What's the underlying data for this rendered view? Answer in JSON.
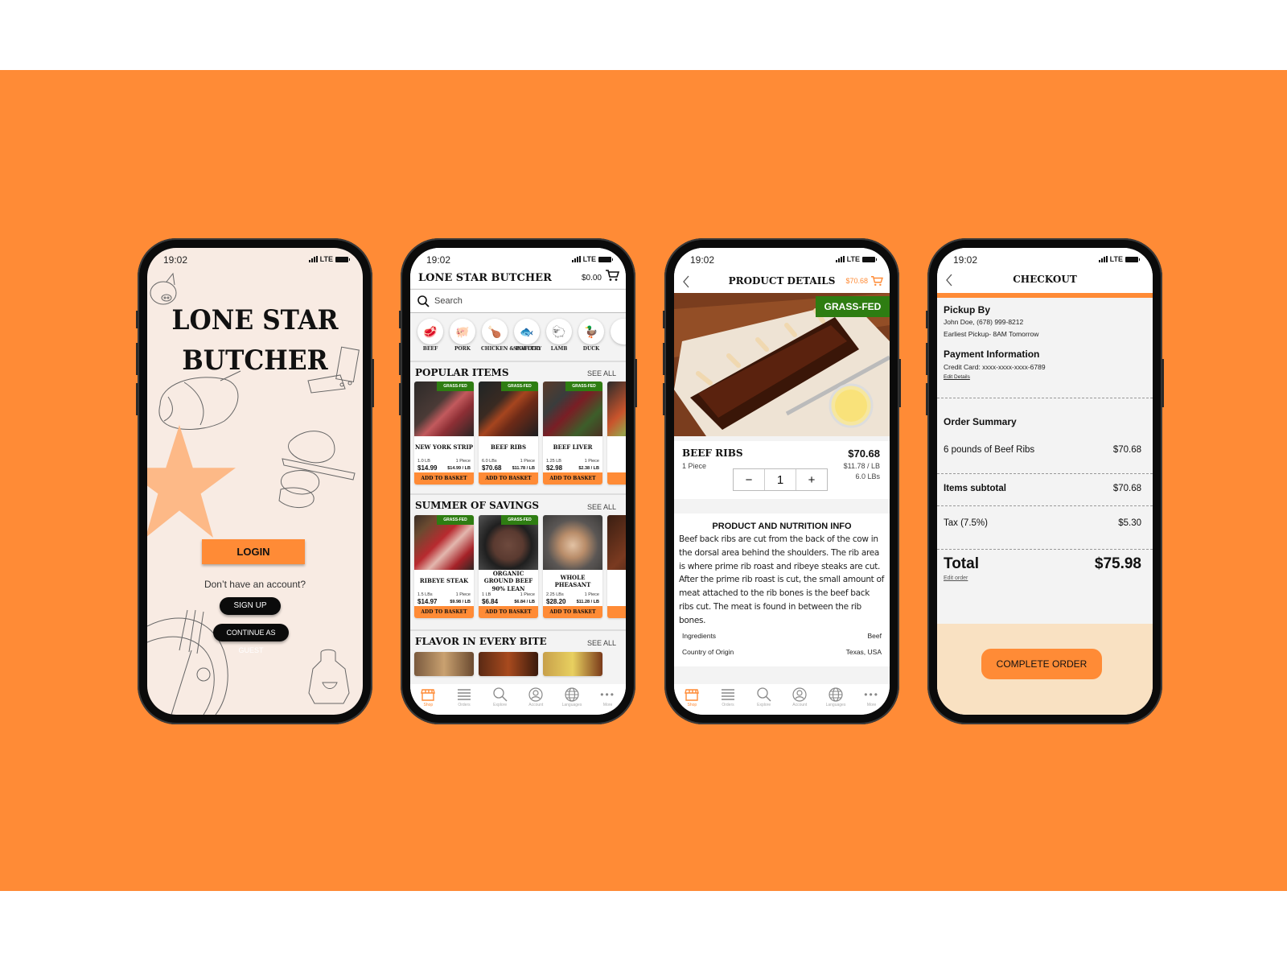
{
  "status_bar": {
    "time": "19:02",
    "network": "LTE"
  },
  "colors": {
    "brand_orange": "#ff8b36",
    "grass_fed_green": "#2e7d12",
    "login_bg": "#f8ebe3",
    "checkout_footer": "#f9e1c2"
  },
  "login_screen": {
    "title_line1": "LONE STAR",
    "title_line2": "BUTCHER",
    "login_label": "LOGIN",
    "no_account_text": "Don’t have an account?",
    "sign_up_label": "SIGN UP",
    "guest_label": "CONTINUE AS GUEST"
  },
  "shop_screen": {
    "brand": "LONE STAR BUTCHER",
    "cart_total": "$0.00",
    "search_placeholder": "Search",
    "categories": [
      {
        "label": "BEEF",
        "icon": "beef-icon"
      },
      {
        "label": "PORK",
        "icon": "pig-icon"
      },
      {
        "label": "CHICKEN & POULTRY",
        "icon": "chicken-icon"
      },
      {
        "label": "SEAFOOD",
        "icon": "fish-icon"
      },
      {
        "label": "LAMB",
        "icon": "lamb-icon"
      },
      {
        "label": "DUCK",
        "icon": "duck-icon"
      }
    ],
    "sections": [
      {
        "title": "POPULAR ITEMS",
        "see_all": "SEE ALL",
        "items": [
          {
            "name": "NEW YORK STRIP",
            "weight": "1.0 LB",
            "pieces": "1 Piece",
            "price": "$14.99",
            "per_lb": "$14.99 / LB",
            "badge": "GRASS-FED",
            "add": "ADD TO BASKET"
          },
          {
            "name": "BEEF RIBS",
            "weight": "6.0 LBs",
            "pieces": "1 Piece",
            "price": "$70.68",
            "per_lb": "$11.78 / LB",
            "badge": "GRASS-FED",
            "add": "ADD TO BASKET"
          },
          {
            "name": "BEEF LIVER",
            "weight": "1.25 LB",
            "pieces": "1 Piece",
            "price": "$2.98",
            "per_lb": "$2.38 / LB",
            "badge": "GRASS-FED",
            "add": "ADD TO BASKET"
          }
        ]
      },
      {
        "title": "SUMMER OF SAVINGS",
        "see_all": "SEE ALL",
        "items": [
          {
            "name": "RIBEYE STEAK",
            "weight": "1.5 LBs",
            "pieces": "1 Piece",
            "price": "$14.97",
            "per_lb": "$9.98 / LB",
            "badge": "GRASS-FED",
            "add": "ADD TO BASKET"
          },
          {
            "name": "ORGANIC GROUND BEEF 90% LEAN",
            "weight": "1 LB",
            "pieces": "1 Piece",
            "price": "$6.84",
            "per_lb": "$6.84 / LB",
            "badge": "GRASS-FED",
            "add": "ADD TO BASKET"
          },
          {
            "name": "WHOLE PHEASANT",
            "weight": "2.25 LBs",
            "pieces": "1 Piece",
            "price": "$28.20",
            "per_lb": "$11.28 / LB",
            "badge": "",
            "add": "ADD TO BASKET"
          }
        ]
      },
      {
        "title": "FLAVOR IN EVERY BITE",
        "see_all": "SEE ALL"
      }
    ]
  },
  "tab_bar": [
    {
      "label": "Shop",
      "icon": "shop-icon",
      "active": true
    },
    {
      "label": "Orders",
      "icon": "list-icon",
      "active": false
    },
    {
      "label": "Explore",
      "icon": "search-icon",
      "active": false
    },
    {
      "label": "Account",
      "icon": "account-icon",
      "active": false
    },
    {
      "label": "Languages",
      "icon": "globe-icon",
      "active": false
    },
    {
      "label": "More",
      "icon": "more-icon",
      "active": false
    }
  ],
  "product_screen": {
    "title": "PRODUCT DETAILS",
    "cart_total": "$70.68",
    "badge": "GRASS-FED",
    "name": "BEEF RIBS",
    "pieces": "1 Piece",
    "price": "$70.68",
    "per_lb": "$11.78 / LB",
    "weight": "6.0 LBs",
    "quantity": "1",
    "minus": "−",
    "plus": "+",
    "info_title": "PRODUCT AND NUTRITION INFO",
    "description": "Beef back ribs are cut from the back of the cow in the dorsal area behind the shoulders. The rib area is where prime rib roast and ribeye steaks are cut. After the prime rib roast is cut, the small amount of meat attached to the rib bones is the beef back ribs cut. The meat is found in between the rib bones.",
    "facts": [
      {
        "label": "Ingredients",
        "value": "Beef"
      },
      {
        "label": "Country of Origin",
        "value": "Texas, USA"
      }
    ]
  },
  "checkout_screen": {
    "title": "CHECKOUT",
    "pickup_heading": "Pickup By",
    "pickup_name": "John Doe, (678) 999-8212",
    "pickup_time": "Earliest Pickup- 8AM Tomorrow",
    "payment_heading": "Payment Information",
    "card": "Credit Card: xxxx-xxxx-xxxx-6789",
    "edit_details": "Edit Details",
    "summary_heading": "Order Summary",
    "line_item": "6 pounds of Beef Ribs",
    "line_item_price": "$70.68",
    "subtotal_label": "Items subtotal",
    "subtotal": "$70.68",
    "tax_label": "Tax (7.5%)",
    "tax": "$5.30",
    "total_label": "Total",
    "total": "$75.98",
    "edit_order": "Edit order",
    "complete_label": "COMPLETE ORDER"
  }
}
